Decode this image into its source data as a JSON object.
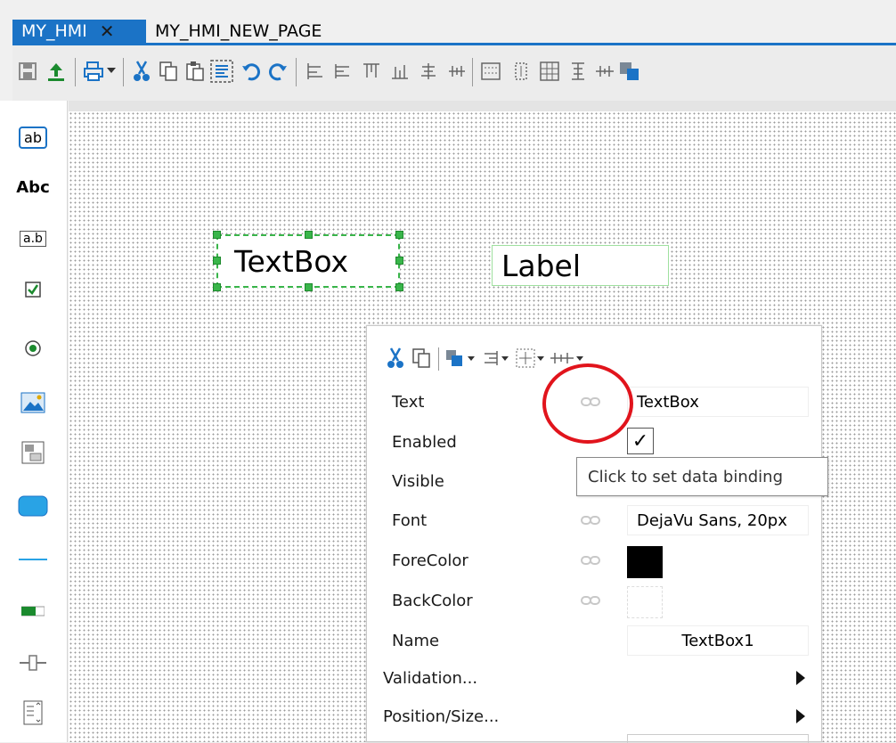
{
  "tabs": [
    {
      "label": "MY_HMI",
      "active": true
    },
    {
      "label": "MY_HMI_NEW_PAGE",
      "active": false
    }
  ],
  "toolbar_icons": [
    "save-icon",
    "upload-icon",
    "print-icon",
    "dropdown-icon",
    "cut-icon",
    "copy-icon",
    "paste-icon",
    "select-all-icon",
    "undo-icon",
    "redo-icon",
    "align-left-icon",
    "align-center-icon",
    "align-top-icon",
    "align-bottom-icon",
    "align-middle-icon",
    "distribute-icon",
    "group-icon",
    "size-icon",
    "grid-icon",
    "space-icon",
    "layer-icon"
  ],
  "toolbox": {
    "items": [
      {
        "name": "textbox-tool-icon",
        "label": "ab"
      },
      {
        "name": "label-tool-icon",
        "label": "Abc"
      },
      {
        "name": "input-tool-icon",
        "label": "a.b"
      },
      {
        "name": "checkbox-tool-icon",
        "label": ""
      },
      {
        "name": "radio-tool-icon",
        "label": ""
      },
      {
        "name": "image-tool-icon",
        "label": ""
      },
      {
        "name": "panel-tool-icon",
        "label": ""
      },
      {
        "name": "button-tool-icon",
        "label": ""
      },
      {
        "name": "line-tool-icon",
        "label": ""
      },
      {
        "name": "progressbar-tool-icon",
        "label": ""
      },
      {
        "name": "slider-tool-icon",
        "label": ""
      },
      {
        "name": "listbox-tool-icon",
        "label": ""
      }
    ]
  },
  "canvas": {
    "textbox": "TextBox",
    "label": "Label"
  },
  "panel": {
    "rows": [
      {
        "label": "Text",
        "value": "TextBox"
      },
      {
        "label": "Enabled",
        "value": "✓"
      },
      {
        "label": "Visible",
        "value": ""
      },
      {
        "label": "Font",
        "value": "DejaVu Sans, 20px"
      },
      {
        "label": "ForeColor",
        "value": ""
      },
      {
        "label": "BackColor",
        "value": ""
      },
      {
        "label": "Name",
        "value": "TextBox1"
      }
    ],
    "groups": [
      {
        "label": "Validation..."
      },
      {
        "label": "Position/Size..."
      }
    ],
    "tooltip": "Click to set data binding"
  },
  "colors": {
    "accent": "#1b73c6",
    "selection": "#39b54a",
    "highlight": "#e1141c",
    "forecolor_swatch": "#000000",
    "backcolor_swatch": "#ffffff"
  }
}
